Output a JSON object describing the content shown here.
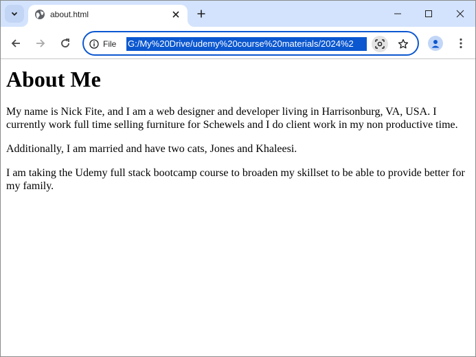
{
  "browser": {
    "tab": {
      "title": "about.html"
    },
    "address_bar": {
      "scheme_chip": "File",
      "url": "G:/My%20Drive/udemy%20course%20materials/2024%2"
    }
  },
  "page": {
    "heading": "About Me",
    "paragraphs": [
      "My name is Nick Fite, and I am a web designer and developer living in Harrisonburg, VA, USA. I currently work full time selling furniture for Schewels and I do client work in my non productive time.",
      "Additionally, I am married and have two cats, Jones and Khaleesi.",
      "I am taking the Udemy full stack bootcamp course to broaden my skillset to be able to provide better for my family."
    ]
  },
  "colors": {
    "tabstrip_bg": "#d3e3fd",
    "accent": "#0b57d0",
    "icon": "#474747"
  },
  "icons": [
    "chevron-down-icon",
    "globe-icon",
    "close-icon",
    "plus-icon",
    "minimize-icon",
    "maximize-icon",
    "back-arrow-icon",
    "forward-arrow-icon",
    "reload-icon",
    "info-icon",
    "lens-icon",
    "star-icon",
    "profile-icon",
    "more-vert-icon"
  ]
}
